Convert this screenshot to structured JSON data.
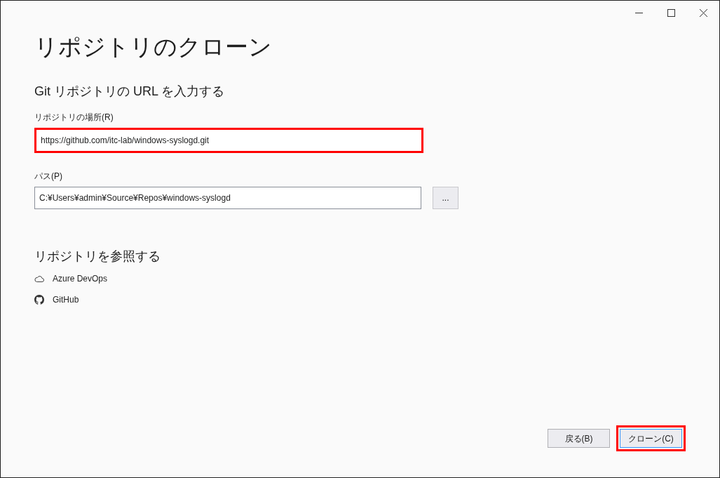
{
  "window": {
    "controls": [
      {
        "kind": "minimize"
      },
      {
        "kind": "maximize"
      },
      {
        "kind": "close"
      }
    ]
  },
  "title": "リポジトリのクローン",
  "url_section": {
    "heading": "Git リポジトリの URL を入力する",
    "location": {
      "label": "リポジトリの場所(R)",
      "value": "https://github.com/itc-lab/windows-syslogd.git",
      "highlighted": true
    },
    "path": {
      "label": "パス(P)",
      "value": "C:¥Users¥admin¥Source¥Repos¥windows-syslogd",
      "highlighted": false
    },
    "browse_button": "..."
  },
  "browse_section": {
    "heading": "リポジトリを参照する",
    "items": [
      {
        "kind": "cloud",
        "label": "Azure DevOps"
      },
      {
        "kind": "github",
        "label": "GitHub"
      }
    ]
  },
  "buttons": [
    {
      "label": "戻る(B)",
      "default": false,
      "highlighted": false
    },
    {
      "label": "クローン(C)",
      "default": true,
      "highlighted": true
    }
  ]
}
